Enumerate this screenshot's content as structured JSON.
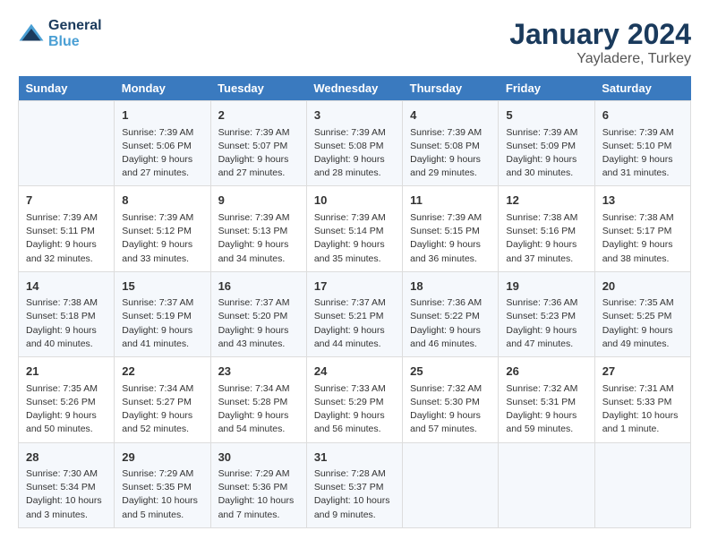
{
  "header": {
    "logo_line1": "General",
    "logo_line2": "Blue",
    "month": "January 2024",
    "location": "Yayladere, Turkey"
  },
  "days_of_week": [
    "Sunday",
    "Monday",
    "Tuesday",
    "Wednesday",
    "Thursday",
    "Friday",
    "Saturday"
  ],
  "weeks": [
    [
      {
        "num": "",
        "info": ""
      },
      {
        "num": "1",
        "info": "Sunrise: 7:39 AM\nSunset: 5:06 PM\nDaylight: 9 hours\nand 27 minutes."
      },
      {
        "num": "2",
        "info": "Sunrise: 7:39 AM\nSunset: 5:07 PM\nDaylight: 9 hours\nand 27 minutes."
      },
      {
        "num": "3",
        "info": "Sunrise: 7:39 AM\nSunset: 5:08 PM\nDaylight: 9 hours\nand 28 minutes."
      },
      {
        "num": "4",
        "info": "Sunrise: 7:39 AM\nSunset: 5:08 PM\nDaylight: 9 hours\nand 29 minutes."
      },
      {
        "num": "5",
        "info": "Sunrise: 7:39 AM\nSunset: 5:09 PM\nDaylight: 9 hours\nand 30 minutes."
      },
      {
        "num": "6",
        "info": "Sunrise: 7:39 AM\nSunset: 5:10 PM\nDaylight: 9 hours\nand 31 minutes."
      }
    ],
    [
      {
        "num": "7",
        "info": "Sunrise: 7:39 AM\nSunset: 5:11 PM\nDaylight: 9 hours\nand 32 minutes."
      },
      {
        "num": "8",
        "info": "Sunrise: 7:39 AM\nSunset: 5:12 PM\nDaylight: 9 hours\nand 33 minutes."
      },
      {
        "num": "9",
        "info": "Sunrise: 7:39 AM\nSunset: 5:13 PM\nDaylight: 9 hours\nand 34 minutes."
      },
      {
        "num": "10",
        "info": "Sunrise: 7:39 AM\nSunset: 5:14 PM\nDaylight: 9 hours\nand 35 minutes."
      },
      {
        "num": "11",
        "info": "Sunrise: 7:39 AM\nSunset: 5:15 PM\nDaylight: 9 hours\nand 36 minutes."
      },
      {
        "num": "12",
        "info": "Sunrise: 7:38 AM\nSunset: 5:16 PM\nDaylight: 9 hours\nand 37 minutes."
      },
      {
        "num": "13",
        "info": "Sunrise: 7:38 AM\nSunset: 5:17 PM\nDaylight: 9 hours\nand 38 minutes."
      }
    ],
    [
      {
        "num": "14",
        "info": "Sunrise: 7:38 AM\nSunset: 5:18 PM\nDaylight: 9 hours\nand 40 minutes."
      },
      {
        "num": "15",
        "info": "Sunrise: 7:37 AM\nSunset: 5:19 PM\nDaylight: 9 hours\nand 41 minutes."
      },
      {
        "num": "16",
        "info": "Sunrise: 7:37 AM\nSunset: 5:20 PM\nDaylight: 9 hours\nand 43 minutes."
      },
      {
        "num": "17",
        "info": "Sunrise: 7:37 AM\nSunset: 5:21 PM\nDaylight: 9 hours\nand 44 minutes."
      },
      {
        "num": "18",
        "info": "Sunrise: 7:36 AM\nSunset: 5:22 PM\nDaylight: 9 hours\nand 46 minutes."
      },
      {
        "num": "19",
        "info": "Sunrise: 7:36 AM\nSunset: 5:23 PM\nDaylight: 9 hours\nand 47 minutes."
      },
      {
        "num": "20",
        "info": "Sunrise: 7:35 AM\nSunset: 5:25 PM\nDaylight: 9 hours\nand 49 minutes."
      }
    ],
    [
      {
        "num": "21",
        "info": "Sunrise: 7:35 AM\nSunset: 5:26 PM\nDaylight: 9 hours\nand 50 minutes."
      },
      {
        "num": "22",
        "info": "Sunrise: 7:34 AM\nSunset: 5:27 PM\nDaylight: 9 hours\nand 52 minutes."
      },
      {
        "num": "23",
        "info": "Sunrise: 7:34 AM\nSunset: 5:28 PM\nDaylight: 9 hours\nand 54 minutes."
      },
      {
        "num": "24",
        "info": "Sunrise: 7:33 AM\nSunset: 5:29 PM\nDaylight: 9 hours\nand 56 minutes."
      },
      {
        "num": "25",
        "info": "Sunrise: 7:32 AM\nSunset: 5:30 PM\nDaylight: 9 hours\nand 57 minutes."
      },
      {
        "num": "26",
        "info": "Sunrise: 7:32 AM\nSunset: 5:31 PM\nDaylight: 9 hours\nand 59 minutes."
      },
      {
        "num": "27",
        "info": "Sunrise: 7:31 AM\nSunset: 5:33 PM\nDaylight: 10 hours\nand 1 minute."
      }
    ],
    [
      {
        "num": "28",
        "info": "Sunrise: 7:30 AM\nSunset: 5:34 PM\nDaylight: 10 hours\nand 3 minutes."
      },
      {
        "num": "29",
        "info": "Sunrise: 7:29 AM\nSunset: 5:35 PM\nDaylight: 10 hours\nand 5 minutes."
      },
      {
        "num": "30",
        "info": "Sunrise: 7:29 AM\nSunset: 5:36 PM\nDaylight: 10 hours\nand 7 minutes."
      },
      {
        "num": "31",
        "info": "Sunrise: 7:28 AM\nSunset: 5:37 PM\nDaylight: 10 hours\nand 9 minutes."
      },
      {
        "num": "",
        "info": ""
      },
      {
        "num": "",
        "info": ""
      },
      {
        "num": "",
        "info": ""
      }
    ]
  ]
}
